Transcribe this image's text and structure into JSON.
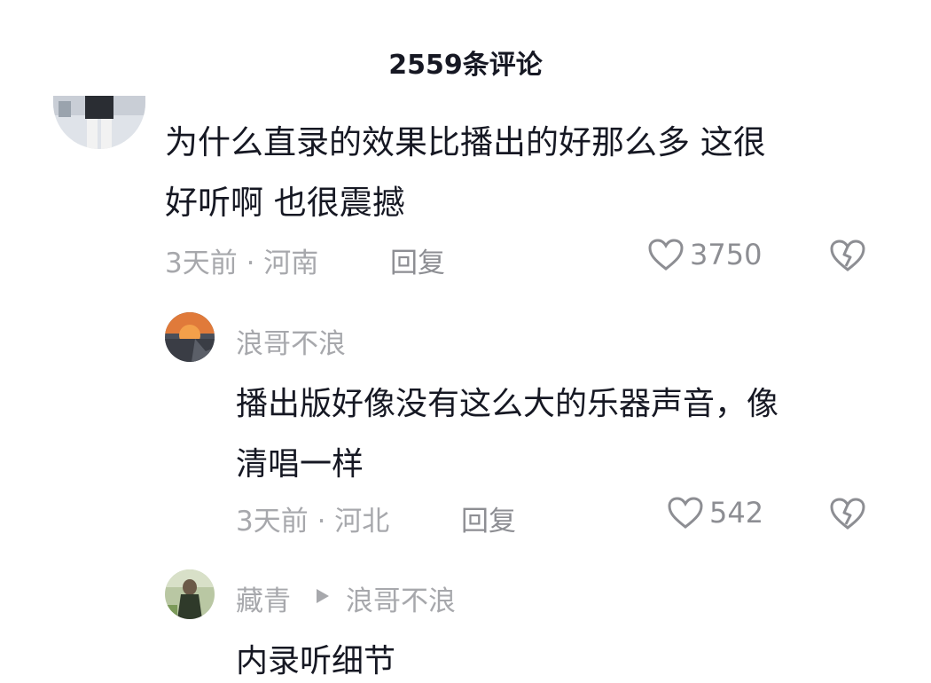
{
  "header": {
    "title": "2559条评论"
  },
  "comments": [
    {
      "text_line1": "为什么直录的效果比播出的好那么多  这很",
      "text_line2": "好听啊 也很震撼",
      "time": "3天前",
      "location": "河南",
      "reply_label": "回复",
      "likes": "3750"
    }
  ],
  "replies": [
    {
      "user": "浪哥不浪",
      "text_line1": "播出版好像没有这么大的乐器声音，像",
      "text_line2": "清唱一样",
      "time": "3天前",
      "location": "河北",
      "reply_label": "回复",
      "likes": "542"
    },
    {
      "user": "藏青",
      "reply_to": "浪哥不浪",
      "text_line1": "内录听细节"
    }
  ],
  "meta_separator": " · ",
  "colors": {
    "text": "#161823",
    "meta": "#a7a8ac",
    "icon": "#8d8e93"
  }
}
